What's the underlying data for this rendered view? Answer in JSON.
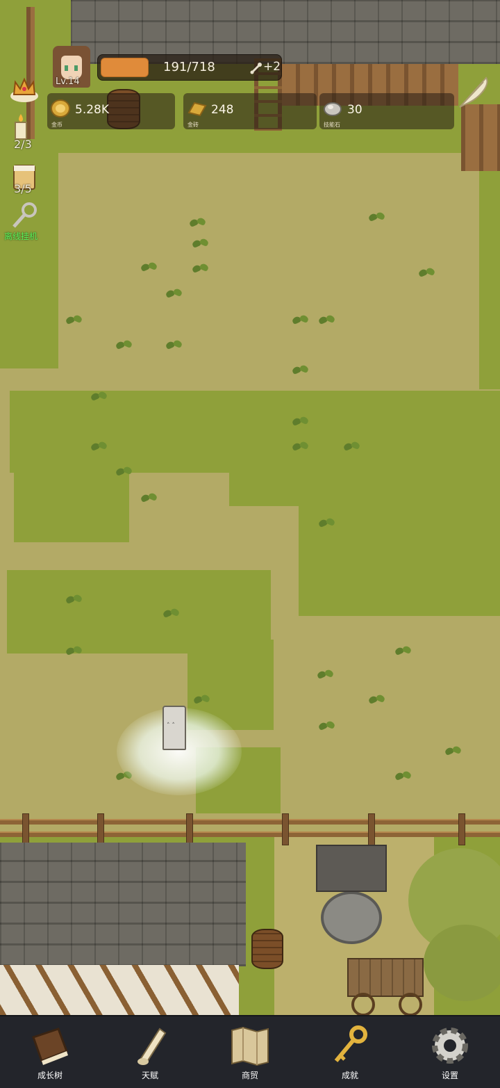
{
  "player": {
    "level": "Lv.14",
    "hp_text": "191/718",
    "hp_fraction": 0.266,
    "bonus": "+2"
  },
  "resources": [
    {
      "icon": "gold-coin-icon",
      "value": "5.28K",
      "label": "金币"
    },
    {
      "icon": "gold-bar-icon",
      "value": "248",
      "label": "金砖"
    },
    {
      "icon": "skill-stone-icon",
      "value": "30",
      "label": "技能石"
    }
  ],
  "side": {
    "candle_count": "2/3",
    "beer_count": "3/5",
    "idle_label": "离线挂机"
  },
  "nav": [
    {
      "icon": "book-icon",
      "label": "成长树"
    },
    {
      "icon": "scroll-icon",
      "label": "天赋"
    },
    {
      "icon": "map-icon",
      "label": "商贸"
    },
    {
      "icon": "key-icon",
      "label": "成就"
    },
    {
      "icon": "gear-icon",
      "label": "设置"
    }
  ],
  "colors": {
    "hp_fill": "#e08b3a",
    "idle_label": "#5df05a",
    "nav_bg": "#23252b"
  }
}
